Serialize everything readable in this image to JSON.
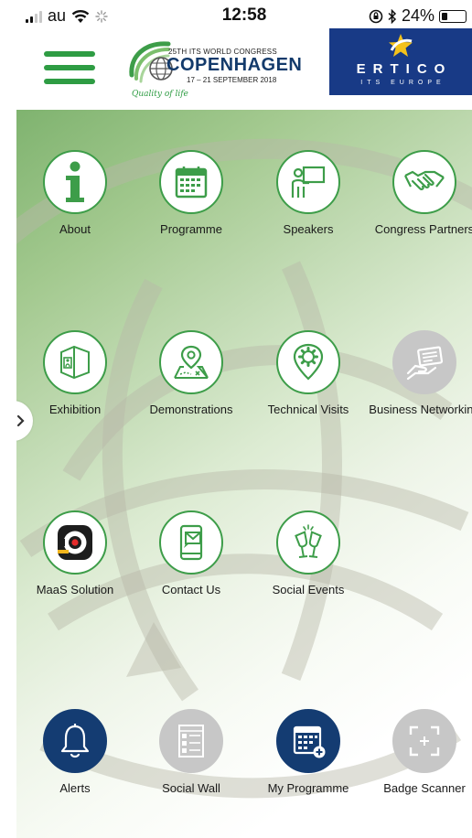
{
  "status_bar": {
    "carrier": "au",
    "time": "12:58",
    "battery": "24%",
    "battery_level": 0.24,
    "icons": [
      "signal-icon",
      "wifi-icon",
      "activity-spinner-icon",
      "orientation-lock-icon",
      "bluetooth-icon",
      "battery-icon"
    ]
  },
  "header": {
    "menu_icon": "hamburger-menu-icon",
    "logo": {
      "ordinal": "25TH",
      "congress": "ITS WORLD CONGRESS",
      "city": "COPENHAGEN",
      "dates": "17 – 21 SEPTEMBER 2018",
      "tagline": "Quality of life"
    },
    "partner": {
      "name": "ERTICO",
      "subtitle": "ITS EUROPE"
    }
  },
  "colors": {
    "brand_green": "#3d9d49",
    "menu_green": "#2e9c43",
    "navy": "#143c72",
    "ertico_blue": "#183a86",
    "disabled_grey": "#c7c7c7"
  },
  "side_tab": {
    "icon": "chevron-right-icon"
  },
  "grid": [
    {
      "label": "About",
      "icon": "info-icon",
      "style": "outline"
    },
    {
      "label": "Programme",
      "icon": "calendar-icon",
      "style": "outline"
    },
    {
      "label": "Speakers",
      "icon": "presenter-icon",
      "style": "outline"
    },
    {
      "label": "Congress Partners",
      "icon": "handshake-icon",
      "style": "outline"
    },
    {
      "label": "Exhibition",
      "icon": "exhibition-booth-icon",
      "style": "outline"
    },
    {
      "label": "Demonstrations",
      "icon": "map-pin-icon",
      "style": "outline"
    },
    {
      "label": "Technical Visits",
      "icon": "gear-pin-icon",
      "style": "outline"
    },
    {
      "label": "Business Networking",
      "icon": "business-card-icon",
      "style": "grey"
    },
    {
      "label": "MaaS Solution",
      "icon": "maas-logo-icon",
      "style": "outline"
    },
    {
      "label": "Contact Us",
      "icon": "phone-message-icon",
      "style": "outline"
    },
    {
      "label": "Social Events",
      "icon": "champagne-glasses-icon",
      "style": "outline"
    }
  ],
  "bottom": [
    {
      "label": "Alerts",
      "icon": "bell-icon",
      "style": "navy"
    },
    {
      "label": "Social Wall",
      "icon": "social-wall-icon",
      "style": "grey"
    },
    {
      "label": "My Programme",
      "icon": "calendar-add-icon",
      "style": "navy"
    },
    {
      "label": "Badge Scanner",
      "icon": "scan-frame-icon",
      "style": "grey"
    }
  ]
}
